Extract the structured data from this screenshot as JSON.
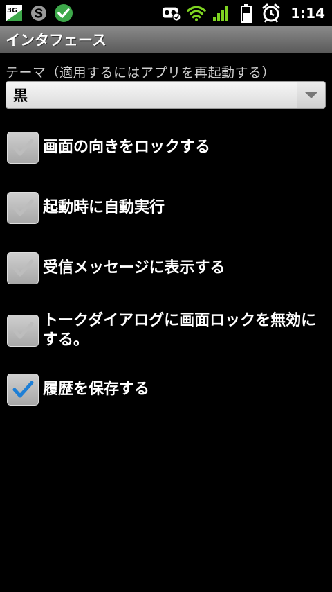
{
  "status_bar": {
    "left_icons": [
      "3g-data-icon",
      "skype-icon",
      "green-check-icon"
    ],
    "right_icons": [
      "voicemail-check-icon",
      "wifi-icon",
      "signal-icon",
      "battery-icon",
      "alarm-icon"
    ],
    "badge_3g": "3G",
    "time": "1:14"
  },
  "title_bar": {
    "title": "インタフェース"
  },
  "theme": {
    "label": "テーマ（適用するにはアプリを再起動する）",
    "selected": "黒"
  },
  "options": [
    {
      "label": "画面の向きをロックする",
      "checked": false
    },
    {
      "label": "起動時に自動実行",
      "checked": false
    },
    {
      "label": "受信メッセージに表示する",
      "checked": false
    },
    {
      "label": "トークダイアログに画面ロックを無効にする。",
      "checked": false
    },
    {
      "label": "履歴を保存する",
      "checked": true
    }
  ],
  "colors": {
    "check_on": "#1e7fd6",
    "check_off": "#bdbdbd",
    "status_green": "#3da84a"
  }
}
